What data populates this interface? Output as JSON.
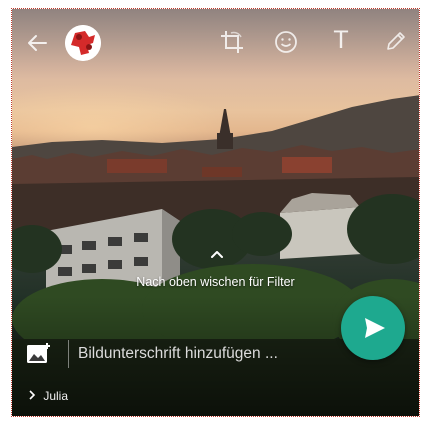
{
  "topbar": {
    "icons": [
      "back-arrow-icon",
      "crop-rotate-icon",
      "emoji-icon",
      "text-icon",
      "pencil-icon"
    ],
    "text_tool_label": "T"
  },
  "hint": {
    "text": "Nach oben wischen für Filter"
  },
  "caption": {
    "placeholder": "Bildunterschrift hinzufügen ..."
  },
  "footer": {
    "recipient": "Julia"
  },
  "colors": {
    "send_button": "#1ea98f",
    "frame_border": "#c0392b"
  }
}
